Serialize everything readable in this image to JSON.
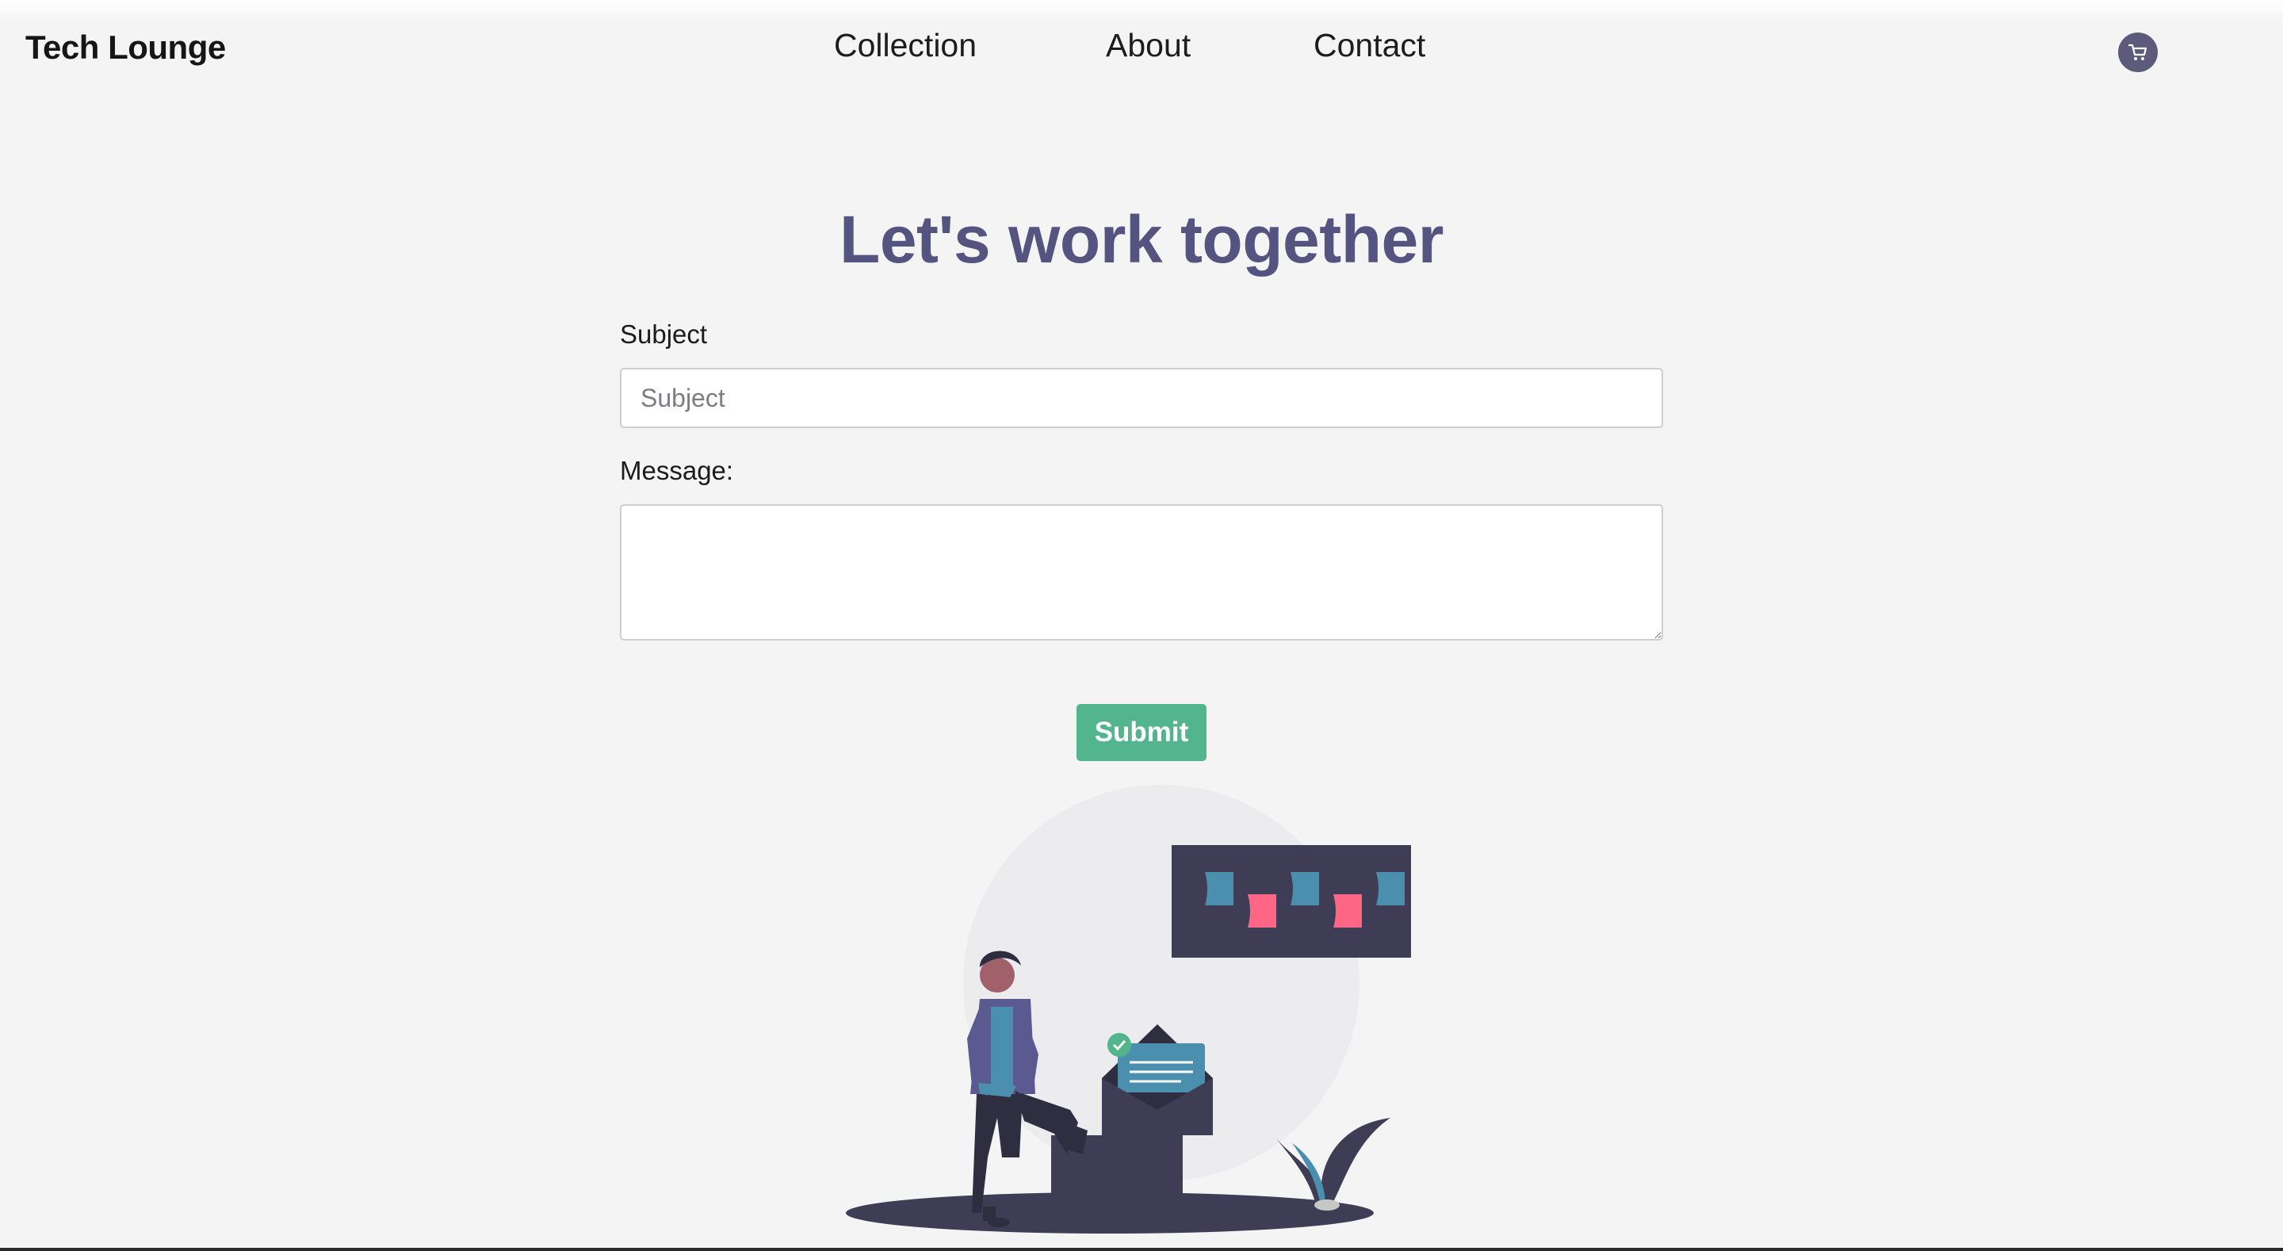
{
  "brand": "Tech Lounge",
  "nav": {
    "collection": "Collection",
    "about": "About",
    "contact": "Contact"
  },
  "cart": {
    "icon": "cart-icon"
  },
  "heading": "Let's work together",
  "form": {
    "subject_label": "Subject",
    "subject_placeholder": "Subject",
    "subject_value": "",
    "message_label": "Message:",
    "message_value": "",
    "submit_label": "Submit"
  },
  "colors": {
    "background": "#f4f4f4",
    "heading": "#555481",
    "submit": "#52b58e",
    "cart": "#5c5b7b"
  }
}
